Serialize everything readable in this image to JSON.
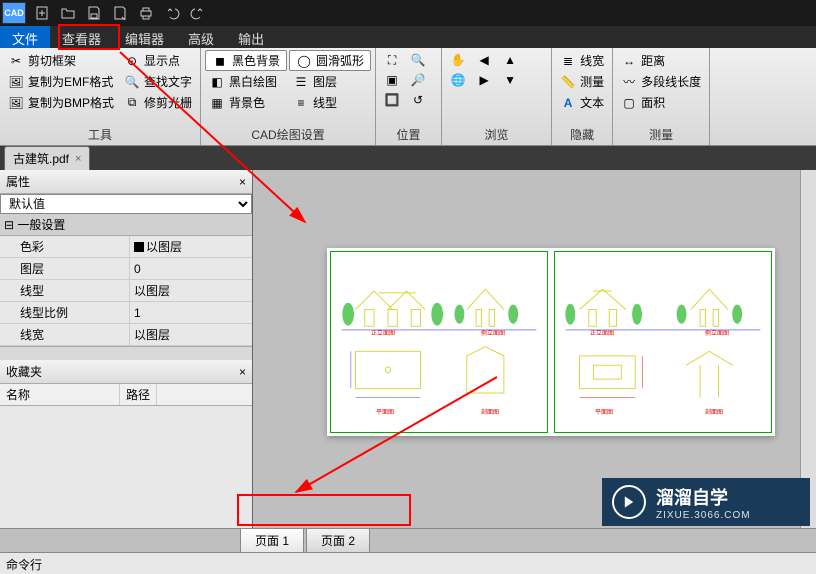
{
  "app_icon": "CAD",
  "qat": [
    "new",
    "open",
    "save",
    "saveas",
    "print",
    "undo",
    "redo"
  ],
  "menu": {
    "items": [
      "文件",
      "查看器",
      "编辑器",
      "高级",
      "输出"
    ],
    "active_index": 0,
    "highlight_index": 1
  },
  "ribbon": {
    "groups": [
      {
        "label": "工具",
        "cols": [
          [
            {
              "icon": "scissors",
              "text": "剪切框架"
            },
            {
              "icon": "emf",
              "text": "复制为EMF格式"
            },
            {
              "icon": "bmp",
              "text": "复制为BMP格式"
            }
          ],
          [
            {
              "icon": "dot",
              "text": "显示点"
            },
            {
              "icon": "search",
              "text": "查找文字"
            },
            {
              "icon": "crop",
              "text": "修剪光栅"
            }
          ]
        ]
      },
      {
        "label": "CAD绘图设置",
        "cols": [
          [
            {
              "icon": "bg-black",
              "text": "黑色背景",
              "framed": true
            },
            {
              "icon": "bw",
              "text": "黑白绘图"
            },
            {
              "icon": "bgcolor",
              "text": "背景色"
            }
          ],
          [
            {
              "icon": "arc",
              "text": "圆滑弧形",
              "framed": true
            },
            {
              "icon": "layers",
              "text": "图层"
            },
            {
              "icon": "linetype",
              "text": "线型"
            }
          ]
        ]
      },
      {
        "label": "位置",
        "cols": [
          [
            {
              "icon": "zoom-ext"
            },
            {
              "icon": "sel-all"
            },
            {
              "icon": "zoom-win"
            }
          ],
          [
            {
              "icon": "zoom-in"
            },
            {
              "icon": "zoom-out"
            },
            {
              "icon": "zoom-prev"
            }
          ]
        ]
      },
      {
        "label": "浏览",
        "cols": [
          [
            {
              "icon": "pan"
            },
            {
              "icon": "orbit"
            }
          ],
          [
            {
              "icon": "nav-l"
            },
            {
              "icon": "nav-r"
            }
          ],
          [
            {
              "icon": "nav-u"
            },
            {
              "icon": "nav-d"
            }
          ]
        ]
      },
      {
        "label": "隐藏",
        "cols": [
          [
            {
              "icon": "linew",
              "text": "线宽"
            },
            {
              "icon": "measure",
              "text": "测量"
            },
            {
              "icon": "text",
              "text": "文本"
            }
          ]
        ]
      },
      {
        "label": "测量",
        "cols": [
          [
            {
              "icon": "dist",
              "text": "距离"
            },
            {
              "icon": "polylen",
              "text": "多段线长度"
            },
            {
              "icon": "area",
              "text": "面积"
            }
          ]
        ]
      }
    ]
  },
  "doctab": {
    "name": "古建筑.pdf",
    "close": "×"
  },
  "panels": {
    "props_title": "属性",
    "default_combo": "默认值",
    "category": "一般设置",
    "rows": [
      {
        "name": "色彩",
        "val": "以图层",
        "swatch": true
      },
      {
        "name": "图层",
        "val": "0"
      },
      {
        "name": "线型",
        "val": "以图层"
      },
      {
        "name": "线型比例",
        "val": "1"
      },
      {
        "name": "线宽",
        "val": "以图层"
      }
    ],
    "fav_title": "收藏夹",
    "fav_cols": [
      "名称",
      "路径"
    ]
  },
  "page_tabs": [
    "页面 1",
    "页面 2"
  ],
  "cmd_label": "命令行",
  "watermark": {
    "brand": "溜溜自学",
    "url": "ZIXUE.3066.COM"
  },
  "preview_labels": [
    "正立面图",
    "侧立面图",
    "正立面图",
    "侧立面图",
    "平面图",
    "剖面图",
    "平面图",
    "剖面图"
  ]
}
